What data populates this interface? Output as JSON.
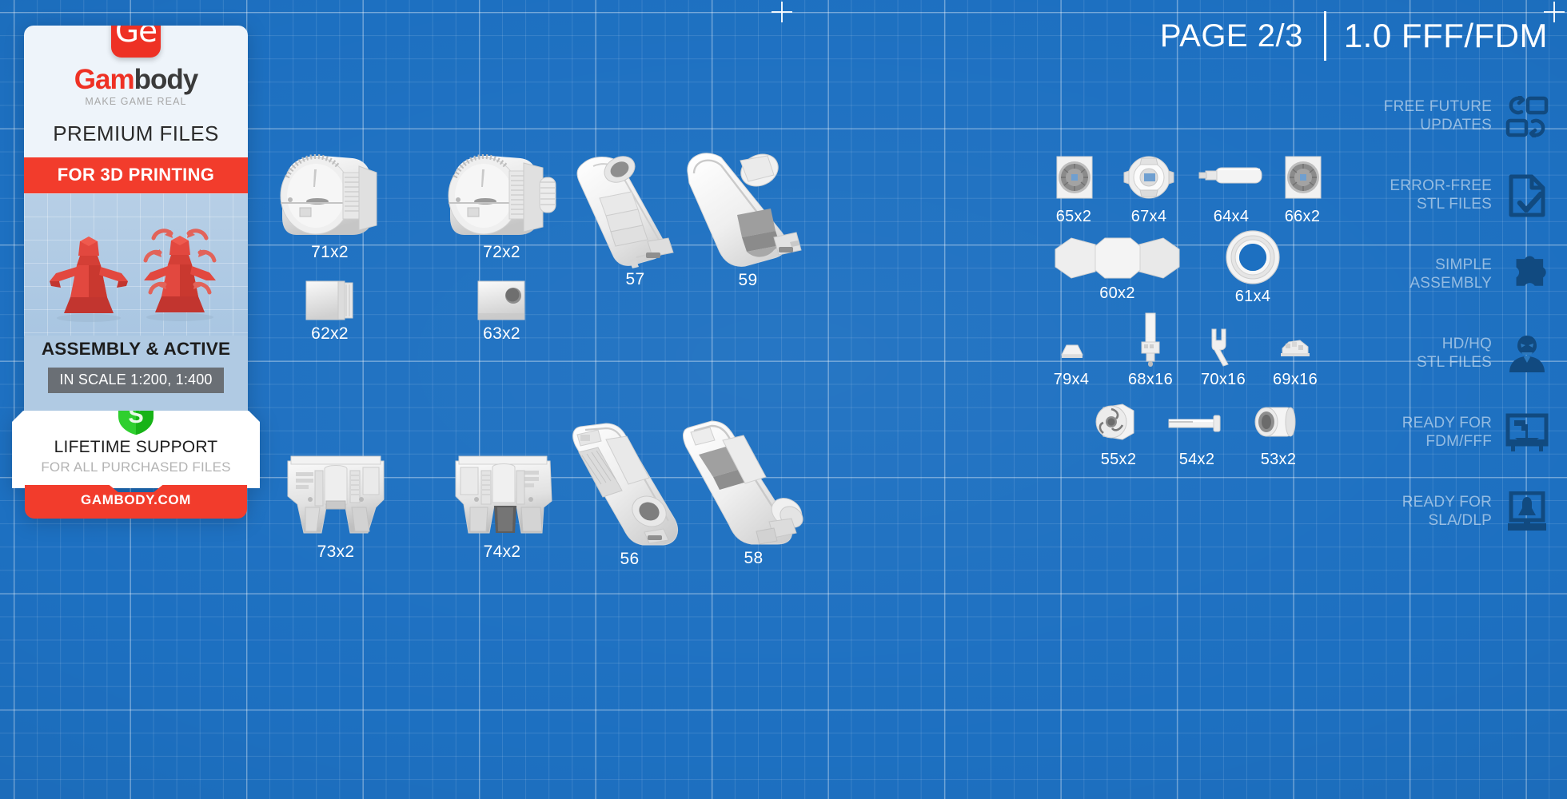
{
  "header": {
    "page_label": "PAGE 2/3",
    "version_label": "1.0 FFF/FDM"
  },
  "promo_card": {
    "logo_text": "Ge",
    "brand_red": "Gam",
    "brand_dark": "body",
    "tagline": "MAKE GAME REAL",
    "premium_files": "PREMIUM FILES",
    "for_3d_printing": "FOR 3D PRINTING",
    "assembly_active": "ASSEMBLY & ACTIVE",
    "scale_badge": "IN SCALE 1:200, 1:400",
    "shield_letter": "S",
    "support_title": "LIFETIME SUPPORT",
    "support_sub": "FOR ALL PURCHASED FILES",
    "site": "GAMBODY.COM",
    "accent_red": "#f23c2c",
    "shield_green": "#25c226"
  },
  "features": [
    {
      "line1": "FREE FUTURE",
      "line2": "UPDATES",
      "icon": "refresh-squares-icon"
    },
    {
      "line1": "ERROR-FREE",
      "line2": "STL FILES",
      "icon": "document-check-icon"
    },
    {
      "line1": "SIMPLE",
      "line2": "ASSEMBLY",
      "icon": "puzzle-piece-icon"
    },
    {
      "line1": "HD/HQ",
      "line2": "STL FILES",
      "icon": "hd-bust-icon"
    },
    {
      "line1": "READY FOR",
      "line2": "FDM/FFF",
      "icon": "fdm-printer-icon"
    },
    {
      "line1": "READY FOR",
      "line2": "SLA/DLP",
      "icon": "sla-printer-icon"
    }
  ],
  "parts": [
    {
      "label": "71x2",
      "shape": "engine-pod"
    },
    {
      "label": "72x2",
      "shape": "engine-pod-b"
    },
    {
      "label": "57",
      "shape": "wing-narrow"
    },
    {
      "label": "59",
      "shape": "wing-wide"
    },
    {
      "label": "62x2",
      "shape": "block-plate"
    },
    {
      "label": "63x2",
      "shape": "block-hole"
    },
    {
      "label": "73x2",
      "shape": "thruster-block"
    },
    {
      "label": "74x2",
      "shape": "thruster-block-b"
    },
    {
      "label": "56",
      "shape": "wing-narrow-b"
    },
    {
      "label": "58",
      "shape": "wing-wide-b"
    },
    {
      "label": "65x2",
      "shape": "disc-in-frame"
    },
    {
      "label": "67x4",
      "shape": "hub-ring"
    },
    {
      "label": "64x4",
      "shape": "rod-pin"
    },
    {
      "label": "66x2",
      "shape": "disc-in-frame"
    },
    {
      "label": "60x2",
      "shape": "bowtie-link"
    },
    {
      "label": "61x4",
      "shape": "torus-ring"
    },
    {
      "label": "79x4",
      "shape": "cone-stub"
    },
    {
      "label": "68x16",
      "shape": "antenna-pin"
    },
    {
      "label": "70x16",
      "shape": "clip-hook"
    },
    {
      "label": "69x16",
      "shape": "tiny-greeble"
    },
    {
      "label": "55x2",
      "shape": "hex-nut"
    },
    {
      "label": "54x2",
      "shape": "long-screw"
    },
    {
      "label": "53x2",
      "shape": "barrel-nut"
    }
  ],
  "colors": {
    "blueprint_bg": "#1d70c1",
    "grid_line": "#ffffff",
    "part_white": "#f2f2f2"
  }
}
